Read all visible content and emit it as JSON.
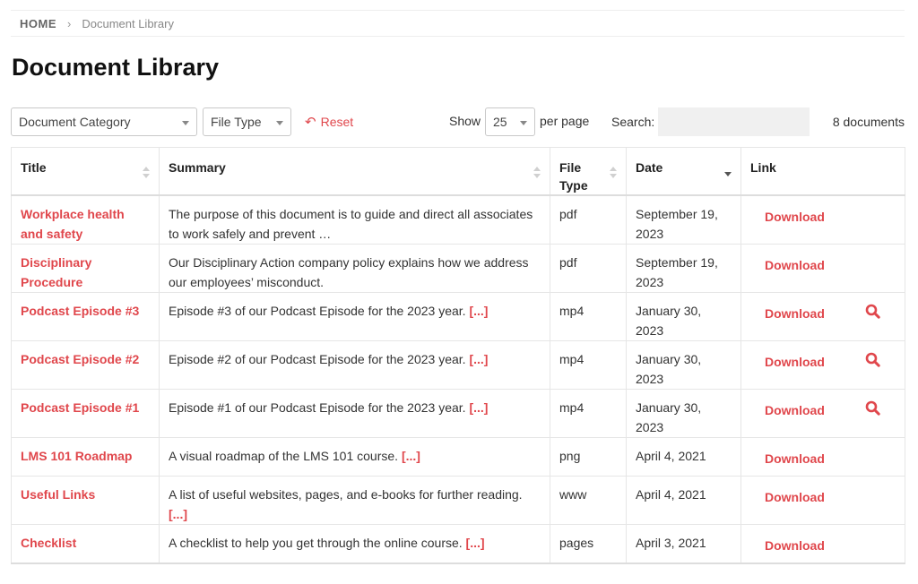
{
  "breadcrumb": {
    "home": "HOME",
    "separator": "›",
    "current": "Document Library"
  },
  "page_title": "Document Library",
  "filters": {
    "category": "Document Category",
    "file_type": "File Type",
    "reset": "Reset",
    "show_label": "Show",
    "page_size": "25",
    "per_page_label": "per page",
    "search_label": "Search:",
    "search_value": "",
    "count": "8 documents"
  },
  "columns": {
    "title": "Title",
    "summary": "Summary",
    "file_type": "File Type",
    "date": "Date",
    "link": "Link"
  },
  "more_label": "[...]",
  "download_label": "Download",
  "accent_color": "#e0474c",
  "sorted_column": "Date (descending)",
  "rows": [
    {
      "title": "Workplace health and safety",
      "summary": "The purpose of this document is to guide and direct all associates to work safely and prevent …",
      "file_type": "pdf",
      "date": "September 19, 2023",
      "preview": false
    },
    {
      "title": "Disciplinary Procedure",
      "summary": "Our Disciplinary Action company policy explains how we address our employees’ misconduct.",
      "file_type": "pdf",
      "date": "September 19, 2023",
      "preview": false
    },
    {
      "title": "Podcast Episode #3",
      "summary": "Episode #3 of our Podcast Episode for the 2023 year.",
      "file_type": "mp4",
      "date": "January 30, 2023",
      "preview": true
    },
    {
      "title": "Podcast Episode #2",
      "summary": "Episode #2 of our Podcast Episode for the 2023 year.",
      "file_type": "mp4",
      "date": "January 30, 2023",
      "preview": true
    },
    {
      "title": "Podcast Episode #1",
      "summary": "Episode #1 of our Podcast Episode for the 2023 year.",
      "file_type": "mp4",
      "date": "January 30, 2023",
      "preview": true
    },
    {
      "title": "LMS 101 Roadmap",
      "summary": "A visual roadmap of the LMS 101 course.",
      "file_type": "png",
      "date": "April 4, 2021",
      "preview": false
    },
    {
      "title": "Useful Links",
      "summary": "A list of useful websites, pages, and e-books for further reading.",
      "file_type": "www",
      "date": "April 4, 2021",
      "preview": false
    },
    {
      "title": "Checklist",
      "summary": "A checklist to help you get through the online course.",
      "file_type": "pages",
      "date": "April 3, 2021",
      "preview": false
    }
  ]
}
